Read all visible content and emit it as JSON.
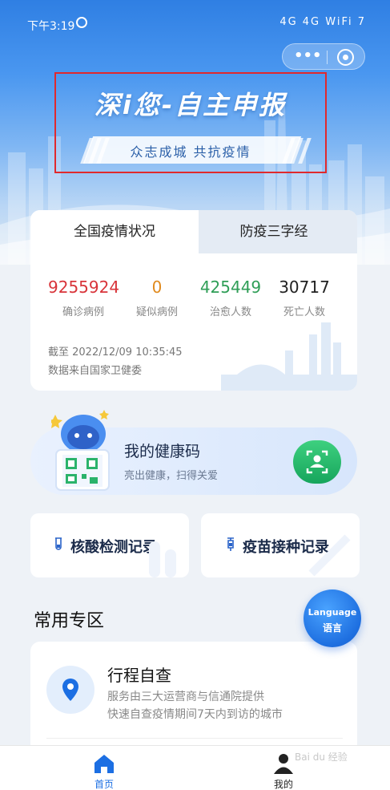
{
  "status_bar": {
    "time": "下午3:19",
    "indicators": "4G 4G WiFi 7"
  },
  "mini_program_capsule": {
    "more_icon": "more-dots-icon",
    "close_icon": "target-circle-icon"
  },
  "banner": {
    "title": "深i您-自主申报",
    "slogan": "众志成城  共抗疫情"
  },
  "tabs": [
    {
      "label": "全国疫情状况",
      "active": true
    },
    {
      "label": "防疫三字经",
      "active": false
    }
  ],
  "stats": [
    {
      "value": "9255924",
      "label": "确诊病例",
      "color": "#d8343a"
    },
    {
      "value": "0",
      "label": "疑似病例",
      "color": "#e08a1e"
    },
    {
      "value": "425449",
      "label": "治愈人数",
      "color": "#2f9e57"
    },
    {
      "value": "30717",
      "label": "死亡人数",
      "color": "#222222"
    }
  ],
  "stats_meta": {
    "as_of": "截至 2022/12/09 10:35:45",
    "source": "数据来自国家卫健委"
  },
  "health_code": {
    "title": "我的健康码",
    "subtitle": "亮出健康，扫得关爱"
  },
  "records": [
    {
      "label": "核酸检测记录",
      "icon": "test-tube-icon"
    },
    {
      "label": "疫苗接种记录",
      "icon": "syringe-icon"
    }
  ],
  "section": {
    "title": "常用专区"
  },
  "language_button": {
    "en": "Language",
    "zh": "语言"
  },
  "list_item": {
    "title": "行程自查",
    "desc_line1": "服务由三大运营商与信通院提供",
    "desc_line2": "快速自查疫情期间7天内到访的城市"
  },
  "bottom_nav": [
    {
      "label": "首页",
      "icon": "home-icon",
      "active": true
    },
    {
      "label": "我的",
      "icon": "person-icon",
      "active": false
    }
  ],
  "watermark": "Bai du 经验",
  "colors": {
    "primary": "#1c6fe3",
    "banner_highlight": "#e0292d",
    "scan_green": "#16a55c"
  }
}
